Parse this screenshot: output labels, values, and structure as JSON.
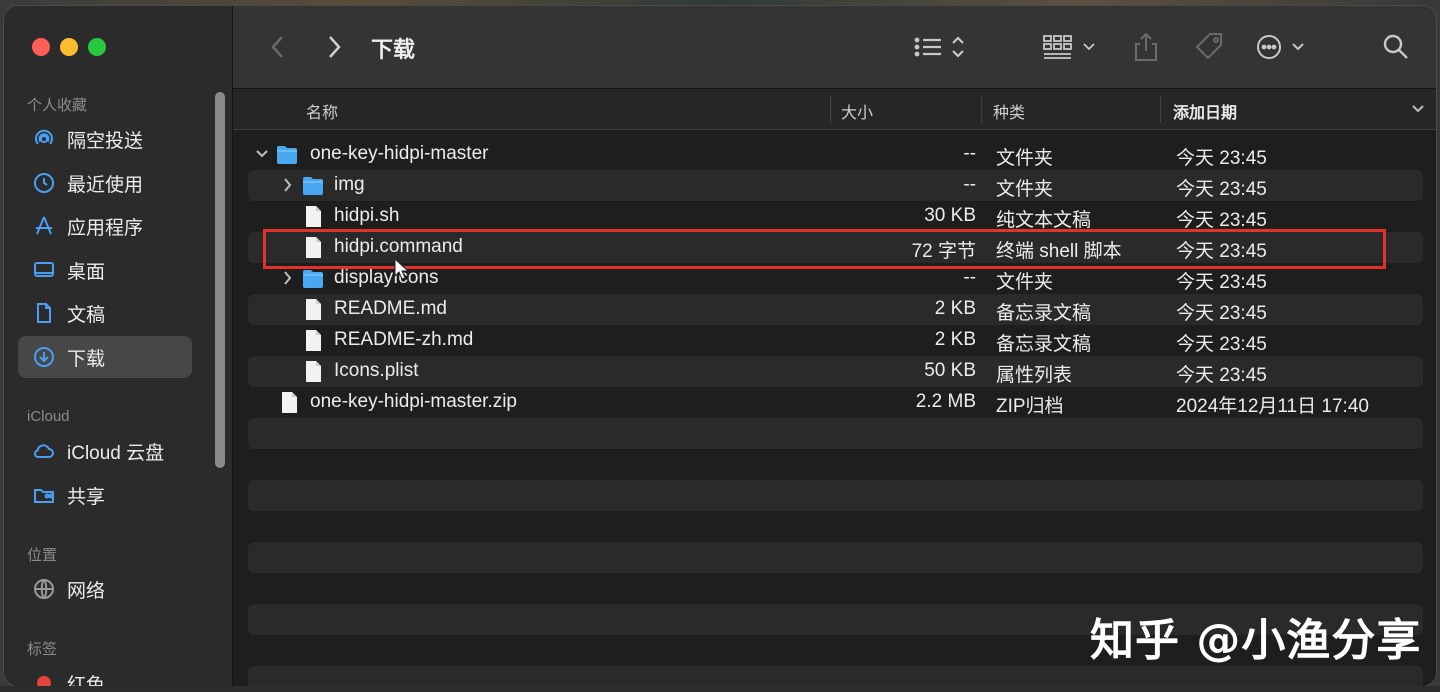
{
  "window": {
    "title": "下载"
  },
  "toolbar": {
    "back_icon": "chevron-left-icon",
    "forward_icon": "chevron-right-icon"
  },
  "sidebar": {
    "sections": [
      {
        "label": "个人收藏"
      },
      {
        "label": "iCloud"
      },
      {
        "label": "位置"
      },
      {
        "label": "标签"
      }
    ],
    "items": [
      {
        "label": "隔空投送",
        "icon": "airdrop-icon"
      },
      {
        "label": "最近使用",
        "icon": "clock-icon"
      },
      {
        "label": "应用程序",
        "icon": "applications-icon"
      },
      {
        "label": "桌面",
        "icon": "desktop-icon"
      },
      {
        "label": "文稿",
        "icon": "document-icon"
      },
      {
        "label": "下载",
        "icon": "download-icon",
        "selected": true
      },
      {
        "label": "iCloud 云盘",
        "icon": "cloud-icon"
      },
      {
        "label": "共享",
        "icon": "shared-folder-icon"
      },
      {
        "label": "网络",
        "icon": "network-icon"
      },
      {
        "label": "红色",
        "icon": "red-tag-icon",
        "color": "#e5453c"
      }
    ]
  },
  "columns": {
    "name": "名称",
    "size": "大小",
    "kind": "种类",
    "date": "添加日期"
  },
  "rows": [
    {
      "name": "one-key-hidpi-master",
      "size": "--",
      "kind": "文件夹",
      "date": "今天 23:45",
      "type": "folder",
      "expanded": true
    },
    {
      "name": "img",
      "size": "--",
      "kind": "文件夹",
      "date": "今天 23:45",
      "type": "folder",
      "expanded": false
    },
    {
      "name": "hidpi.sh",
      "size": "30 KB",
      "kind": "纯文本文稿",
      "date": "今天 23:45",
      "type": "file"
    },
    {
      "name": "hidpi.command",
      "size": "72 字节",
      "kind": "终端 shell 脚本",
      "date": "今天 23:45",
      "type": "file"
    },
    {
      "name": "displayIcons",
      "size": "--",
      "kind": "文件夹",
      "date": "今天 23:45",
      "type": "folder",
      "expanded": false
    },
    {
      "name": "README.md",
      "size": "2 KB",
      "kind": "备忘录文稿",
      "date": "今天 23:45",
      "type": "file"
    },
    {
      "name": "README-zh.md",
      "size": "2 KB",
      "kind": "备忘录文稿",
      "date": "今天 23:45",
      "type": "file"
    },
    {
      "name": "Icons.plist",
      "size": "50 KB",
      "kind": "属性列表",
      "date": "今天 23:45",
      "type": "file"
    },
    {
      "name": "one-key-hidpi-master.zip",
      "size": "2.2 MB",
      "kind": "ZIP归档",
      "date": "2024年12月11日 17:40",
      "type": "file"
    }
  ],
  "watermark": "知乎 @小渔分享",
  "colors": {
    "accent": "#4a9ff5",
    "highlight": "#e2322a",
    "folder": "#4aa8f0"
  }
}
